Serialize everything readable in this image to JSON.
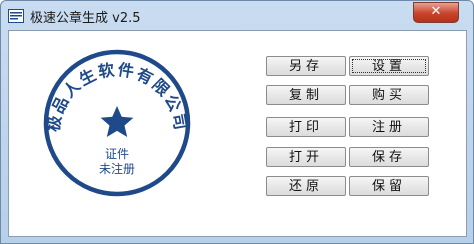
{
  "window": {
    "title": "极速公章生成 v2.5",
    "close_label": "✕"
  },
  "seal": {
    "arc_text": "极品人生软件有限公司",
    "center_lines": [
      "证件",
      "未注册"
    ],
    "color": "#1f4a8a"
  },
  "buttons": {
    "save_as": "另存",
    "settings": "设置",
    "copy": "复制",
    "buy": "购买",
    "print": "打印",
    "register": "注册",
    "open": "打开",
    "save": "保存",
    "restore": "还原",
    "keep": "保留"
  }
}
